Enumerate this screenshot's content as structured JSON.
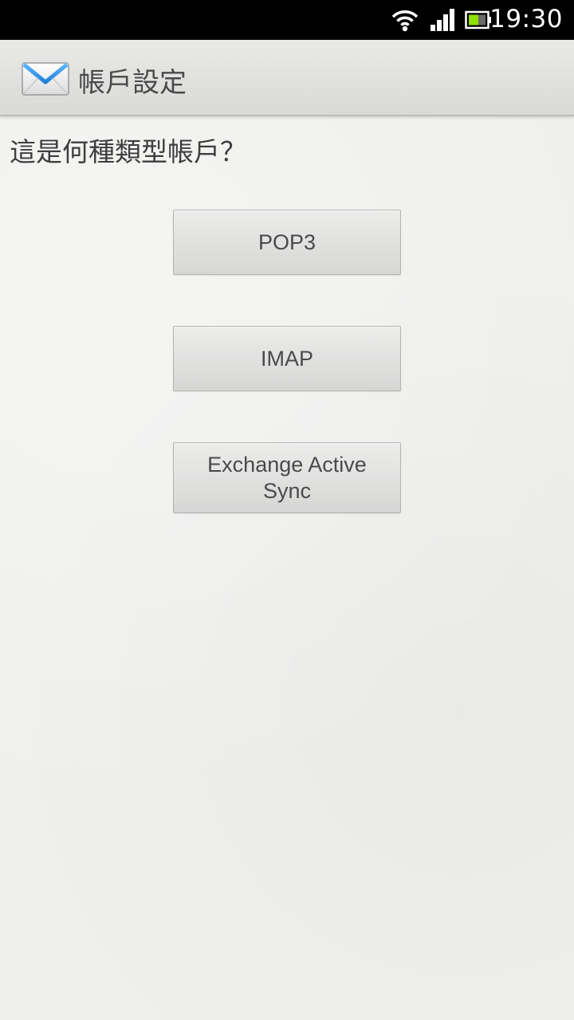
{
  "status_bar": {
    "time": "19:30",
    "icons": [
      "wifi-icon",
      "signal-icon",
      "battery-icon"
    ]
  },
  "action_bar": {
    "icon": "mail-icon",
    "title": "帳戶設定"
  },
  "content": {
    "question": "這是何種類型帳戶？",
    "buttons": [
      {
        "label": "POP3"
      },
      {
        "label": "IMAP"
      },
      {
        "label": "Exchange Active Sync"
      }
    ]
  },
  "colors": {
    "background": "#efefed",
    "status_bar": "#000000",
    "text": "#4a4a4a"
  }
}
